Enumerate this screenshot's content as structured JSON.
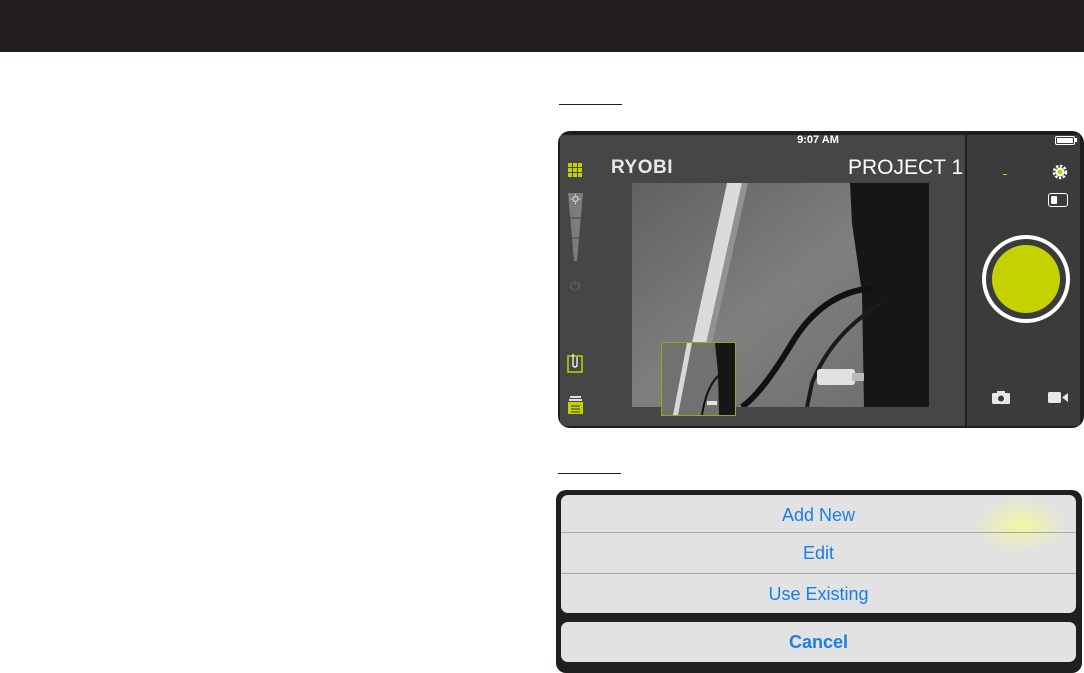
{
  "device": {
    "status_time": "9:07 AM",
    "brand": "RYOBI",
    "project_title": "PROJECT 1",
    "accent_color": "#c5d100",
    "icons": {
      "menu": "grid-icon",
      "brightness": "brightness-icon",
      "power": "power-icon",
      "clip": "clip-icon",
      "gallery": "stack-icon",
      "settings": "gear-icon",
      "toggle": "toggle-icon",
      "shutter": "shutter-button",
      "photo": "camera-icon",
      "video": "video-icon"
    }
  },
  "action_sheet": {
    "items": [
      {
        "label": "Add New"
      },
      {
        "label": "Edit"
      },
      {
        "label": "Use Existing"
      }
    ],
    "cancel_label": "Cancel",
    "text_color": "#1a7fe5"
  }
}
